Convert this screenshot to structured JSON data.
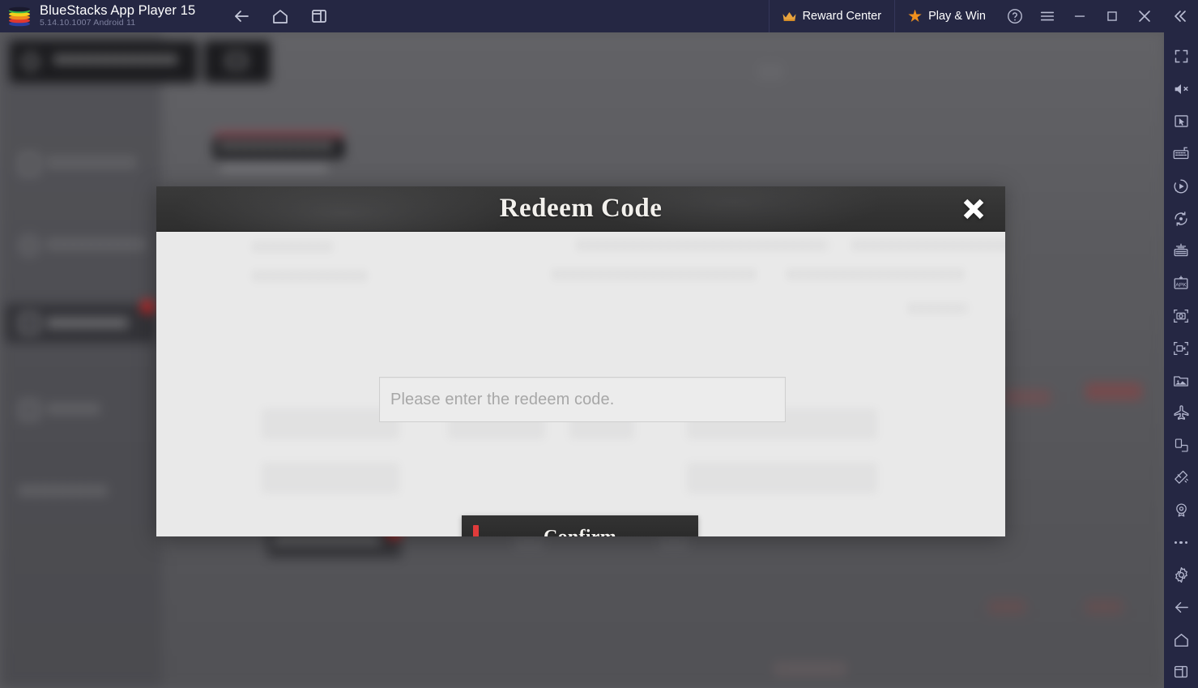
{
  "titlebar": {
    "app_name": "BlueStacks App Player 15",
    "version_line": "5.14.10.1007  Android 11",
    "logo_icon": "bluestacks-logo",
    "nav": [
      {
        "icon": "back-arrow-icon",
        "name": "android-back"
      },
      {
        "icon": "home-icon",
        "name": "android-home"
      },
      {
        "icon": "recents-icon",
        "name": "android-recents"
      }
    ],
    "reward_center": {
      "label": "Reward Center",
      "icon": "crown-icon"
    },
    "play_and_win": {
      "label": "Play & Win",
      "icon": "star-icon"
    },
    "right_icons": [
      {
        "name": "help-icon",
        "label": "?"
      },
      {
        "name": "menu-icon",
        "label": "≡"
      },
      {
        "name": "minimize-icon",
        "label": "–"
      },
      {
        "name": "maximize-icon",
        "label": "□"
      },
      {
        "name": "close-icon",
        "label": "✕"
      },
      {
        "name": "collapse-sidebar-icon",
        "label": "«"
      }
    ]
  },
  "sidebar": {
    "items": [
      {
        "name": "fullscreen-icon"
      },
      {
        "name": "mute-icon"
      },
      {
        "name": "cursor-pointer-icon"
      },
      {
        "name": "game-controls-icon"
      },
      {
        "name": "macro-recorder-icon"
      },
      {
        "name": "sync-operations-icon"
      },
      {
        "name": "multi-instance-icon"
      },
      {
        "name": "install-apk-icon"
      },
      {
        "name": "screenshot-icon"
      },
      {
        "name": "screen-record-icon"
      },
      {
        "name": "media-manager-icon"
      },
      {
        "name": "eco-mode-icon"
      },
      {
        "name": "rotate-icon"
      },
      {
        "name": "shake-icon"
      },
      {
        "name": "location-icon"
      },
      {
        "name": "more-options-icon"
      },
      {
        "name": "settings-gear-icon"
      },
      {
        "name": "back-icon"
      },
      {
        "name": "home-icon"
      },
      {
        "name": "recents-icon"
      }
    ]
  },
  "modal": {
    "title": "Redeem Code",
    "close_icon": "close-x-icon",
    "input": {
      "placeholder": "Please enter the redeem code.",
      "value": ""
    },
    "confirm_label": "Confirm"
  },
  "colors": {
    "titlebar_bg": "#252743",
    "sidebar_bg": "#252743",
    "modal_header_bg": "#333333",
    "modal_body_bg": "#e9e9e9",
    "confirm_bg": "#2b2b2b",
    "accent_red": "#e03b3b",
    "badge_red": "#cf2121",
    "play_win_orange": "#f0901e",
    "backdrop_gray": "#5a5a5e"
  }
}
